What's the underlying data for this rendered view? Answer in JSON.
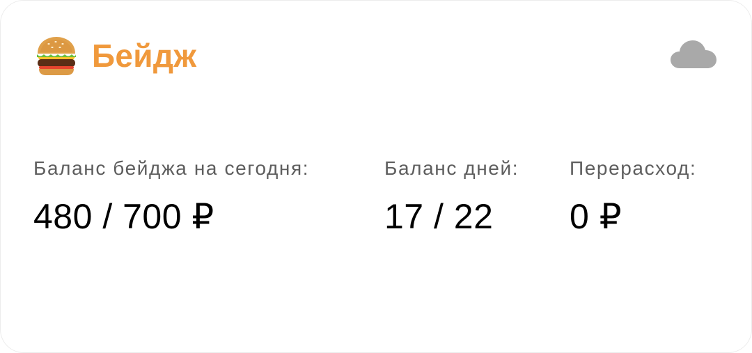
{
  "header": {
    "icon": "burger-icon",
    "title": "Бейдж",
    "status_icon": "cloud-icon"
  },
  "colors": {
    "accent": "#f0993c",
    "label": "#5e5e5e",
    "value": "#000000",
    "cloud": "#a9a9a9"
  },
  "stats": [
    {
      "label": "Баланс бейджа на сегодня:",
      "value": "480 / 700 ₽"
    },
    {
      "label": "Баланс дней:",
      "value": "17 / 22"
    },
    {
      "label": "Перерасход:",
      "value": "0 ₽"
    }
  ]
}
